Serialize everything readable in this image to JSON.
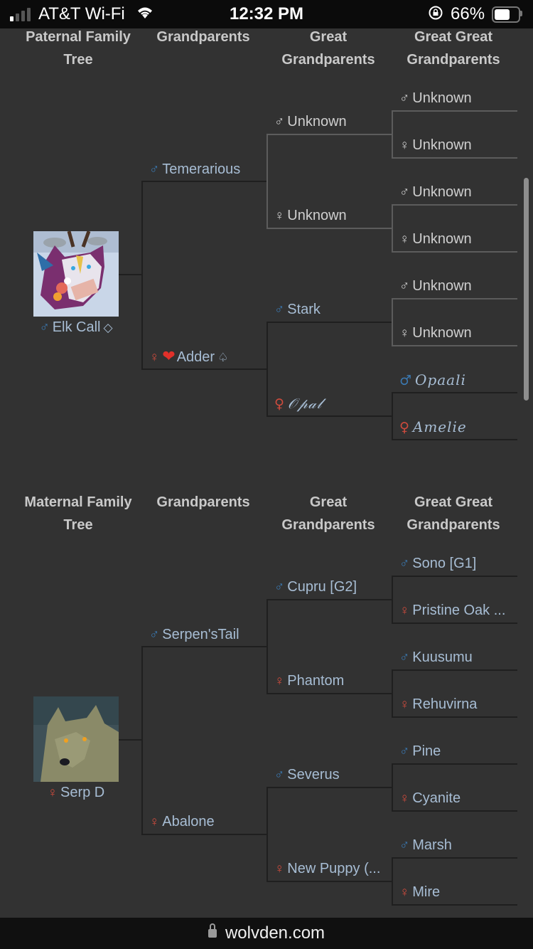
{
  "status_bar": {
    "carrier": "AT&T Wi-Fi",
    "time": "12:32 PM",
    "battery_percent": "66%",
    "battery_level": 0.66,
    "signal_bars_active": 1,
    "signal_bars_total": 4,
    "icons": [
      "signal-icon",
      "wifi-icon",
      "rotation-lock-icon",
      "battery-icon"
    ]
  },
  "paternal": {
    "headers": [
      "Paternal Family Tree",
      "Grandparents",
      "Great Grandparents",
      "Great Great Grandparents"
    ],
    "subject": {
      "name": "Elk Call",
      "gender": "male",
      "suffix": "◇",
      "avatar": "wolf-avatar-elk-call"
    },
    "grandparents": [
      {
        "name": "Temerarious",
        "gender": "male"
      },
      {
        "name": "Adder",
        "gender": "female",
        "prefix_emoji": "❤️",
        "suffix": "♤"
      }
    ],
    "great_grandparents": [
      {
        "name": "Unknown",
        "gender": "male",
        "unknown": true
      },
      {
        "name": "Unknown",
        "gender": "female",
        "unknown": true
      },
      {
        "name": "Stark",
        "gender": "male"
      },
      {
        "name": "𝒪𝓅𝒶𝓁",
        "gender": "female",
        "script": true
      }
    ],
    "great_great_grandparents": [
      {
        "name": "Unknown",
        "gender": "male",
        "unknown": true
      },
      {
        "name": "Unknown",
        "gender": "female",
        "unknown": true
      },
      {
        "name": "Unknown",
        "gender": "male",
        "unknown": true
      },
      {
        "name": "Unknown",
        "gender": "female",
        "unknown": true
      },
      {
        "name": "Unknown",
        "gender": "male",
        "unknown": true
      },
      {
        "name": "Unknown",
        "gender": "female",
        "unknown": true
      },
      {
        "name": "Opaali",
        "gender": "male",
        "script": true
      },
      {
        "name": "Amelie",
        "gender": "female",
        "script": true
      }
    ]
  },
  "maternal": {
    "headers": [
      "Maternal Family Tree",
      "Grandparents",
      "Great Grandparents",
      "Great Great Grandparents"
    ],
    "subject": {
      "name": "Serp D",
      "gender": "female",
      "avatar": "wolf-avatar-serp-d"
    },
    "grandparents": [
      {
        "name": "Serpen'sTail",
        "gender": "male"
      },
      {
        "name": "Abalone",
        "gender": "female"
      }
    ],
    "great_grandparents": [
      {
        "name": "Cupru [G2]",
        "gender": "male"
      },
      {
        "name": "Phantom",
        "gender": "female"
      },
      {
        "name": "Severus",
        "gender": "male"
      },
      {
        "name": "New Puppy (...",
        "gender": "female"
      }
    ],
    "great_great_grandparents": [
      {
        "name": "Sono [G1]",
        "gender": "male"
      },
      {
        "name": "Pristine Oak ...",
        "gender": "female"
      },
      {
        "name": "Kuusumu",
        "gender": "male"
      },
      {
        "name": "Rehuvirna",
        "gender": "female"
      },
      {
        "name": "Pine",
        "gender": "male"
      },
      {
        "name": "Cyanite",
        "gender": "female"
      },
      {
        "name": "Marsh",
        "gender": "male"
      },
      {
        "name": "Mire",
        "gender": "female"
      }
    ]
  },
  "symbols": {
    "male": "♂",
    "female": "♀"
  },
  "colors": {
    "background": "#323232",
    "male": "#3b79b2",
    "female": "#cf4b3d",
    "name_text": "#a7bdd4",
    "unknown_text": "#cfcfcf",
    "header_text": "#c9c9c9"
  },
  "url_bar": {
    "domain": "wolvden.com"
  }
}
